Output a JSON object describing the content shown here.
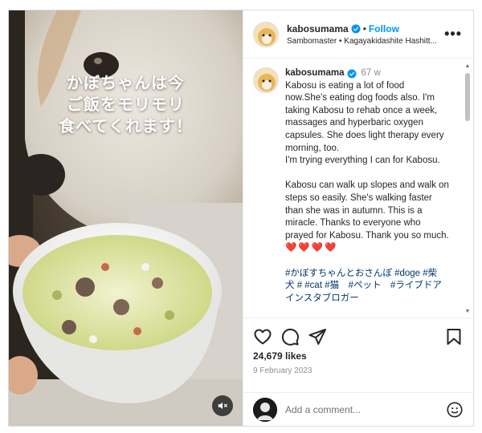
{
  "post": {
    "overlay_lines": [
      "かぼちゃんは今",
      "ご飯をモリモリ",
      "食べてくれます！"
    ],
    "mute_icon": "speaker-muted-icon"
  },
  "header": {
    "username": "kabosumama",
    "follow_label": "Follow",
    "separator": "•",
    "subtitle": "Sambomaster • Kagayakidashite Hashitt...",
    "more_label": "•••"
  },
  "caption": {
    "username": "kabosumama",
    "time": "67 w",
    "lines_a": [
      "Kabosu is eating a lot of food",
      "now.She's eating dog foods also. I'm",
      "taking Kabosu to rehab once a week,",
      "massages and hyperbaric oxygen",
      "capsules. She does light therapy every",
      "morning, too.",
      "I'm trying everything I can for Kabosu."
    ],
    "lines_b": [
      "Kabosu can walk up slopes and walk on",
      "steps so easily. She's walking faster",
      "than she was in autumn. This is a",
      "miracle. Thanks to everyone who",
      "prayed for Kabosu. Thank you so much."
    ],
    "hearts": "❤️❤️❤️❤️",
    "tags_lines": [
      "#かぼすちゃんとおさんぽ #doge #柴",
      "犬 # #cat #猫　#ペット　#ライブドア",
      "インスタブロガー"
    ]
  },
  "actions": {
    "likes": "24,679 likes",
    "date": "9 February 2023"
  },
  "comment_box": {
    "placeholder": "Add a comment..."
  },
  "colors": {
    "accent": "#0095f6",
    "hashtag": "#00376b",
    "muted": "#8e8e8e",
    "verified": "#0095f6"
  }
}
